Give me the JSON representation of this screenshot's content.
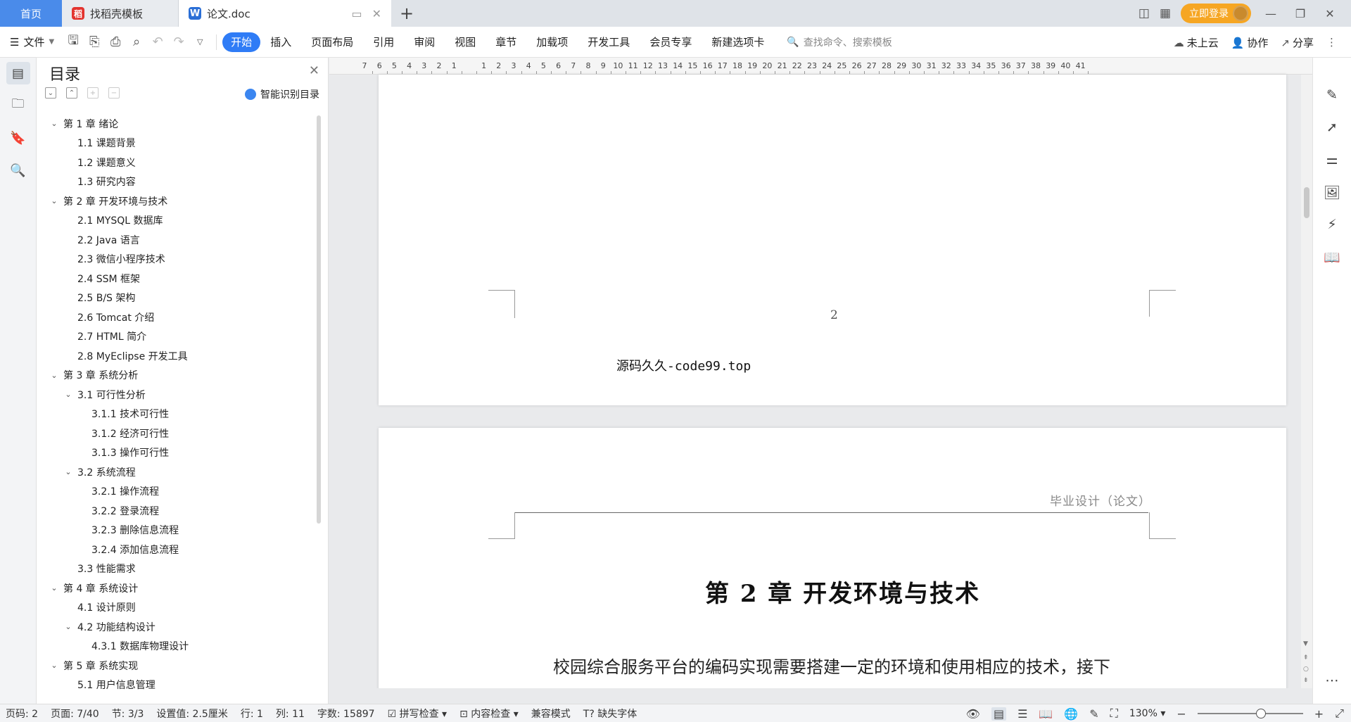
{
  "tabs": {
    "home": "首页",
    "templates": "找稻壳模板",
    "doc": "论文.doc"
  },
  "titlebar": {
    "login": "立即登录"
  },
  "toolbar": {
    "file": "文件",
    "ribbon_tabs": [
      "开始",
      "插入",
      "页面布局",
      "引用",
      "审阅",
      "视图",
      "章节",
      "加载项",
      "开发工具",
      "会员专享",
      "新建选项卡"
    ],
    "search_placeholder": "查找命令、搜索模板",
    "cloud": "未上云",
    "collab": "协作",
    "share": "分享"
  },
  "toc": {
    "title": "目录",
    "smart_label": "智能识别目录",
    "items": [
      {
        "level": 1,
        "arrow": true,
        "text": "第 1 章  绪论"
      },
      {
        "level": 2,
        "arrow": false,
        "text": "1.1  课题背景"
      },
      {
        "level": 2,
        "arrow": false,
        "text": "1.2  课题意义"
      },
      {
        "level": 2,
        "arrow": false,
        "text": "1.3  研究内容"
      },
      {
        "level": 1,
        "arrow": true,
        "text": "第 2 章  开发环境与技术"
      },
      {
        "level": 2,
        "arrow": false,
        "text": "2.1  MYSQL 数据库"
      },
      {
        "level": 2,
        "arrow": false,
        "text": "2.2  Java 语言"
      },
      {
        "level": 2,
        "arrow": false,
        "text": "2.3  微信小程序技术"
      },
      {
        "level": 2,
        "arrow": false,
        "text": "2.4  SSM 框架"
      },
      {
        "level": 2,
        "arrow": false,
        "text": "2.5  B/S 架构"
      },
      {
        "level": 2,
        "arrow": false,
        "text": "2.6  Tomcat  介绍"
      },
      {
        "level": 2,
        "arrow": false,
        "text": "2.7  HTML 简介"
      },
      {
        "level": 2,
        "arrow": false,
        "text": "2.8  MyEclipse 开发工具"
      },
      {
        "level": 1,
        "arrow": true,
        "text": "第 3 章  系统分析"
      },
      {
        "level": 2,
        "arrow": true,
        "text": "3.1  可行性分析"
      },
      {
        "level": 3,
        "arrow": false,
        "text": "3.1.1  技术可行性"
      },
      {
        "level": 3,
        "arrow": false,
        "text": "3.1.2  经济可行性"
      },
      {
        "level": 3,
        "arrow": false,
        "text": "3.1.3  操作可行性"
      },
      {
        "level": 2,
        "arrow": true,
        "text": "3.2  系统流程"
      },
      {
        "level": 3,
        "arrow": false,
        "text": "3.2.1  操作流程"
      },
      {
        "level": 3,
        "arrow": false,
        "text": "3.2.2  登录流程"
      },
      {
        "level": 3,
        "arrow": false,
        "text": "3.2.3  删除信息流程"
      },
      {
        "level": 3,
        "arrow": false,
        "text": "3.2.4  添加信息流程"
      },
      {
        "level": 2,
        "arrow": false,
        "text": "3.3  性能需求"
      },
      {
        "level": 1,
        "arrow": true,
        "text": "第 4 章  系统设计"
      },
      {
        "level": 2,
        "arrow": false,
        "text": "4.1  设计原则"
      },
      {
        "level": 2,
        "arrow": true,
        "text": "4.2  功能结构设计"
      },
      {
        "level": 3,
        "arrow": false,
        "text": "4.3.1  数据库物理设计"
      },
      {
        "level": 1,
        "arrow": true,
        "text": "第 5 章  系统实现"
      },
      {
        "level": 2,
        "arrow": false,
        "text": "5.1 用户信息管理"
      }
    ]
  },
  "ruler": {
    "numbers": [
      "7",
      "6",
      "5",
      "4",
      "3",
      "2",
      "1",
      "",
      "1",
      "2",
      "3",
      "4",
      "5",
      "6",
      "7",
      "8",
      "9",
      "10",
      "11",
      "12",
      "13",
      "14",
      "15",
      "16",
      "17",
      "18",
      "19",
      "20",
      "21",
      "22",
      "23",
      "24",
      "25",
      "26",
      "27",
      "28",
      "29",
      "30",
      "31",
      "32",
      "33",
      "34",
      "35",
      "36",
      "37",
      "38",
      "39",
      "40",
      "41"
    ]
  },
  "document": {
    "page_number": "2",
    "watermark": "源码久久-code99.top",
    "header": "毕业设计（论文）",
    "chapter_title": "第 2 章  开发环境与技术",
    "body": "校园综合服务平台的编码实现需要搭建一定的环境和使用相应的技术，接下"
  },
  "status": {
    "page_code": "页码: 2",
    "page": "页面: 7/40",
    "section": "节: 3/3",
    "setting": "设置值: 2.5厘米",
    "row": "行: 1",
    "col": "列: 11",
    "words": "字数: 15897",
    "spell": "拼写检查",
    "content": "内容检查",
    "compat": "兼容模式",
    "font": "缺失字体",
    "zoom": "130%",
    "zoom_level": 0.6
  }
}
